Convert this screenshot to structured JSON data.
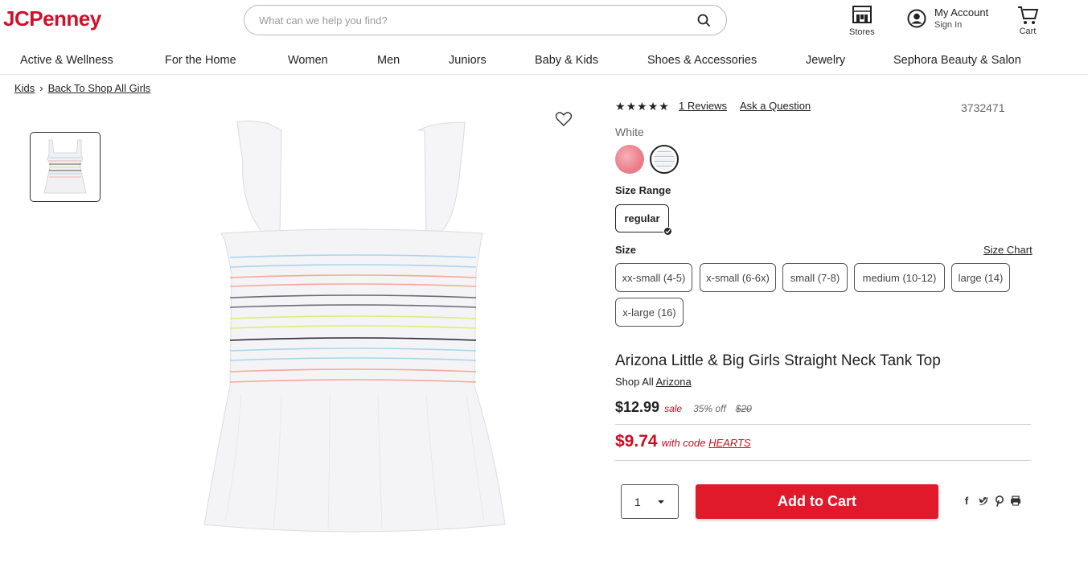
{
  "header": {
    "logo": "JCPenney",
    "search_placeholder": "What can we help you find?",
    "stores_label": "Stores",
    "account_title": "My Account",
    "account_sub": "Sign In",
    "cart_label": "Cart"
  },
  "nav": {
    "items": [
      "Active & Wellness",
      "For the Home",
      "Women",
      "Men",
      "Juniors",
      "Baby & Kids",
      "Shoes & Accessories",
      "Jewelry",
      "Sephora Beauty & Salon"
    ]
  },
  "breadcrumb": {
    "items": [
      "Kids",
      "Back To Shop All Girls"
    ],
    "separator": "›"
  },
  "product": {
    "rating_stars": 5,
    "reviews_link": "1 Reviews",
    "ask_link": "Ask a Question",
    "sku": "3732471",
    "color_name": "White",
    "size_range_label": "Size Range",
    "size_range_selected": "regular",
    "size_label": "Size",
    "size_chart_link": "Size Chart",
    "sizes": [
      "xx-small (4-5)",
      "x-small (6-6x)",
      "small (7-8)",
      "medium (10-12)",
      "large (14)",
      "x-large (16)"
    ],
    "title": "Arizona Little & Big Girls Straight Neck Tank Top",
    "shop_all_prefix": "Shop All",
    "brand": "Arizona",
    "price": "$12.99",
    "sale_label": "sale",
    "discount": "35% off",
    "original_price": "$20",
    "code_price": "$9.74",
    "code_prefix": "with code",
    "code": "HEARTS",
    "quantity": "1",
    "add_to_cart": "Add to Cart",
    "share_icons": [
      "facebook-icon",
      "twitter-icon",
      "pinterest-icon",
      "print-icon"
    ]
  },
  "colors": {
    "brand_red": "#d0112b",
    "button_red": "#e11a2b"
  }
}
